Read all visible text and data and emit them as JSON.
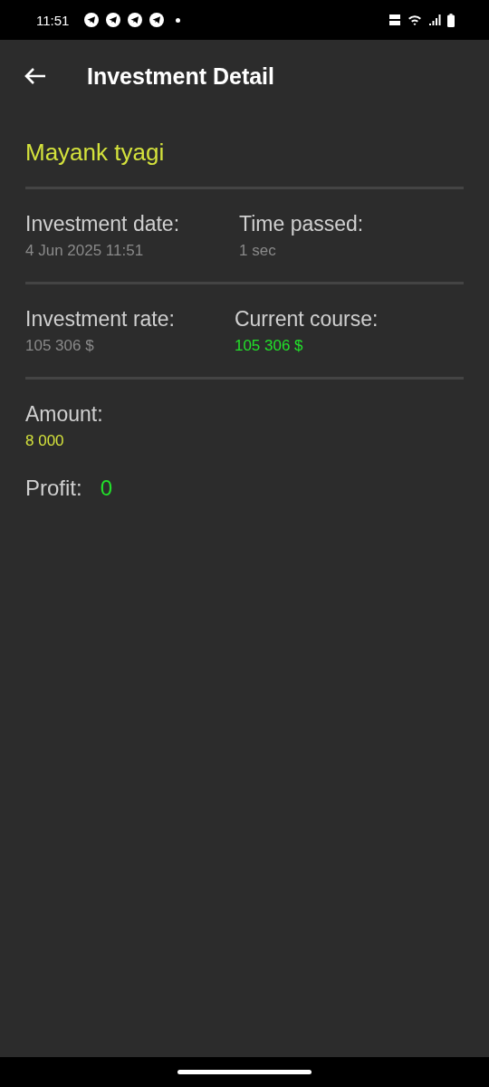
{
  "status_bar": {
    "time": "11:51",
    "notifications": [
      {
        "kind": "telegram"
      },
      {
        "kind": "telegram"
      },
      {
        "kind": "telegram"
      },
      {
        "kind": "telegram"
      }
    ]
  },
  "app_bar": {
    "title": "Investment Detail"
  },
  "investor": {
    "name": "Mayank tyagi"
  },
  "rows": [
    {
      "fields": [
        {
          "label": "Investment date:",
          "value": "4 Jun 2025 11:51",
          "kind": "plain"
        },
        {
          "label": "Time passed:",
          "value": "1 sec",
          "kind": "plain"
        }
      ]
    },
    {
      "fields": [
        {
          "label": "Investment rate:",
          "value": "105 306 $",
          "kind": "plain"
        },
        {
          "label": "Current course:",
          "value": "105 306 $",
          "kind": "gain"
        }
      ]
    },
    {
      "fields": [
        {
          "label": "Amount:",
          "value": "8 000",
          "kind": "amount"
        }
      ]
    }
  ],
  "profit": {
    "label": "Profit:",
    "value": "0",
    "kind": "gain"
  }
}
